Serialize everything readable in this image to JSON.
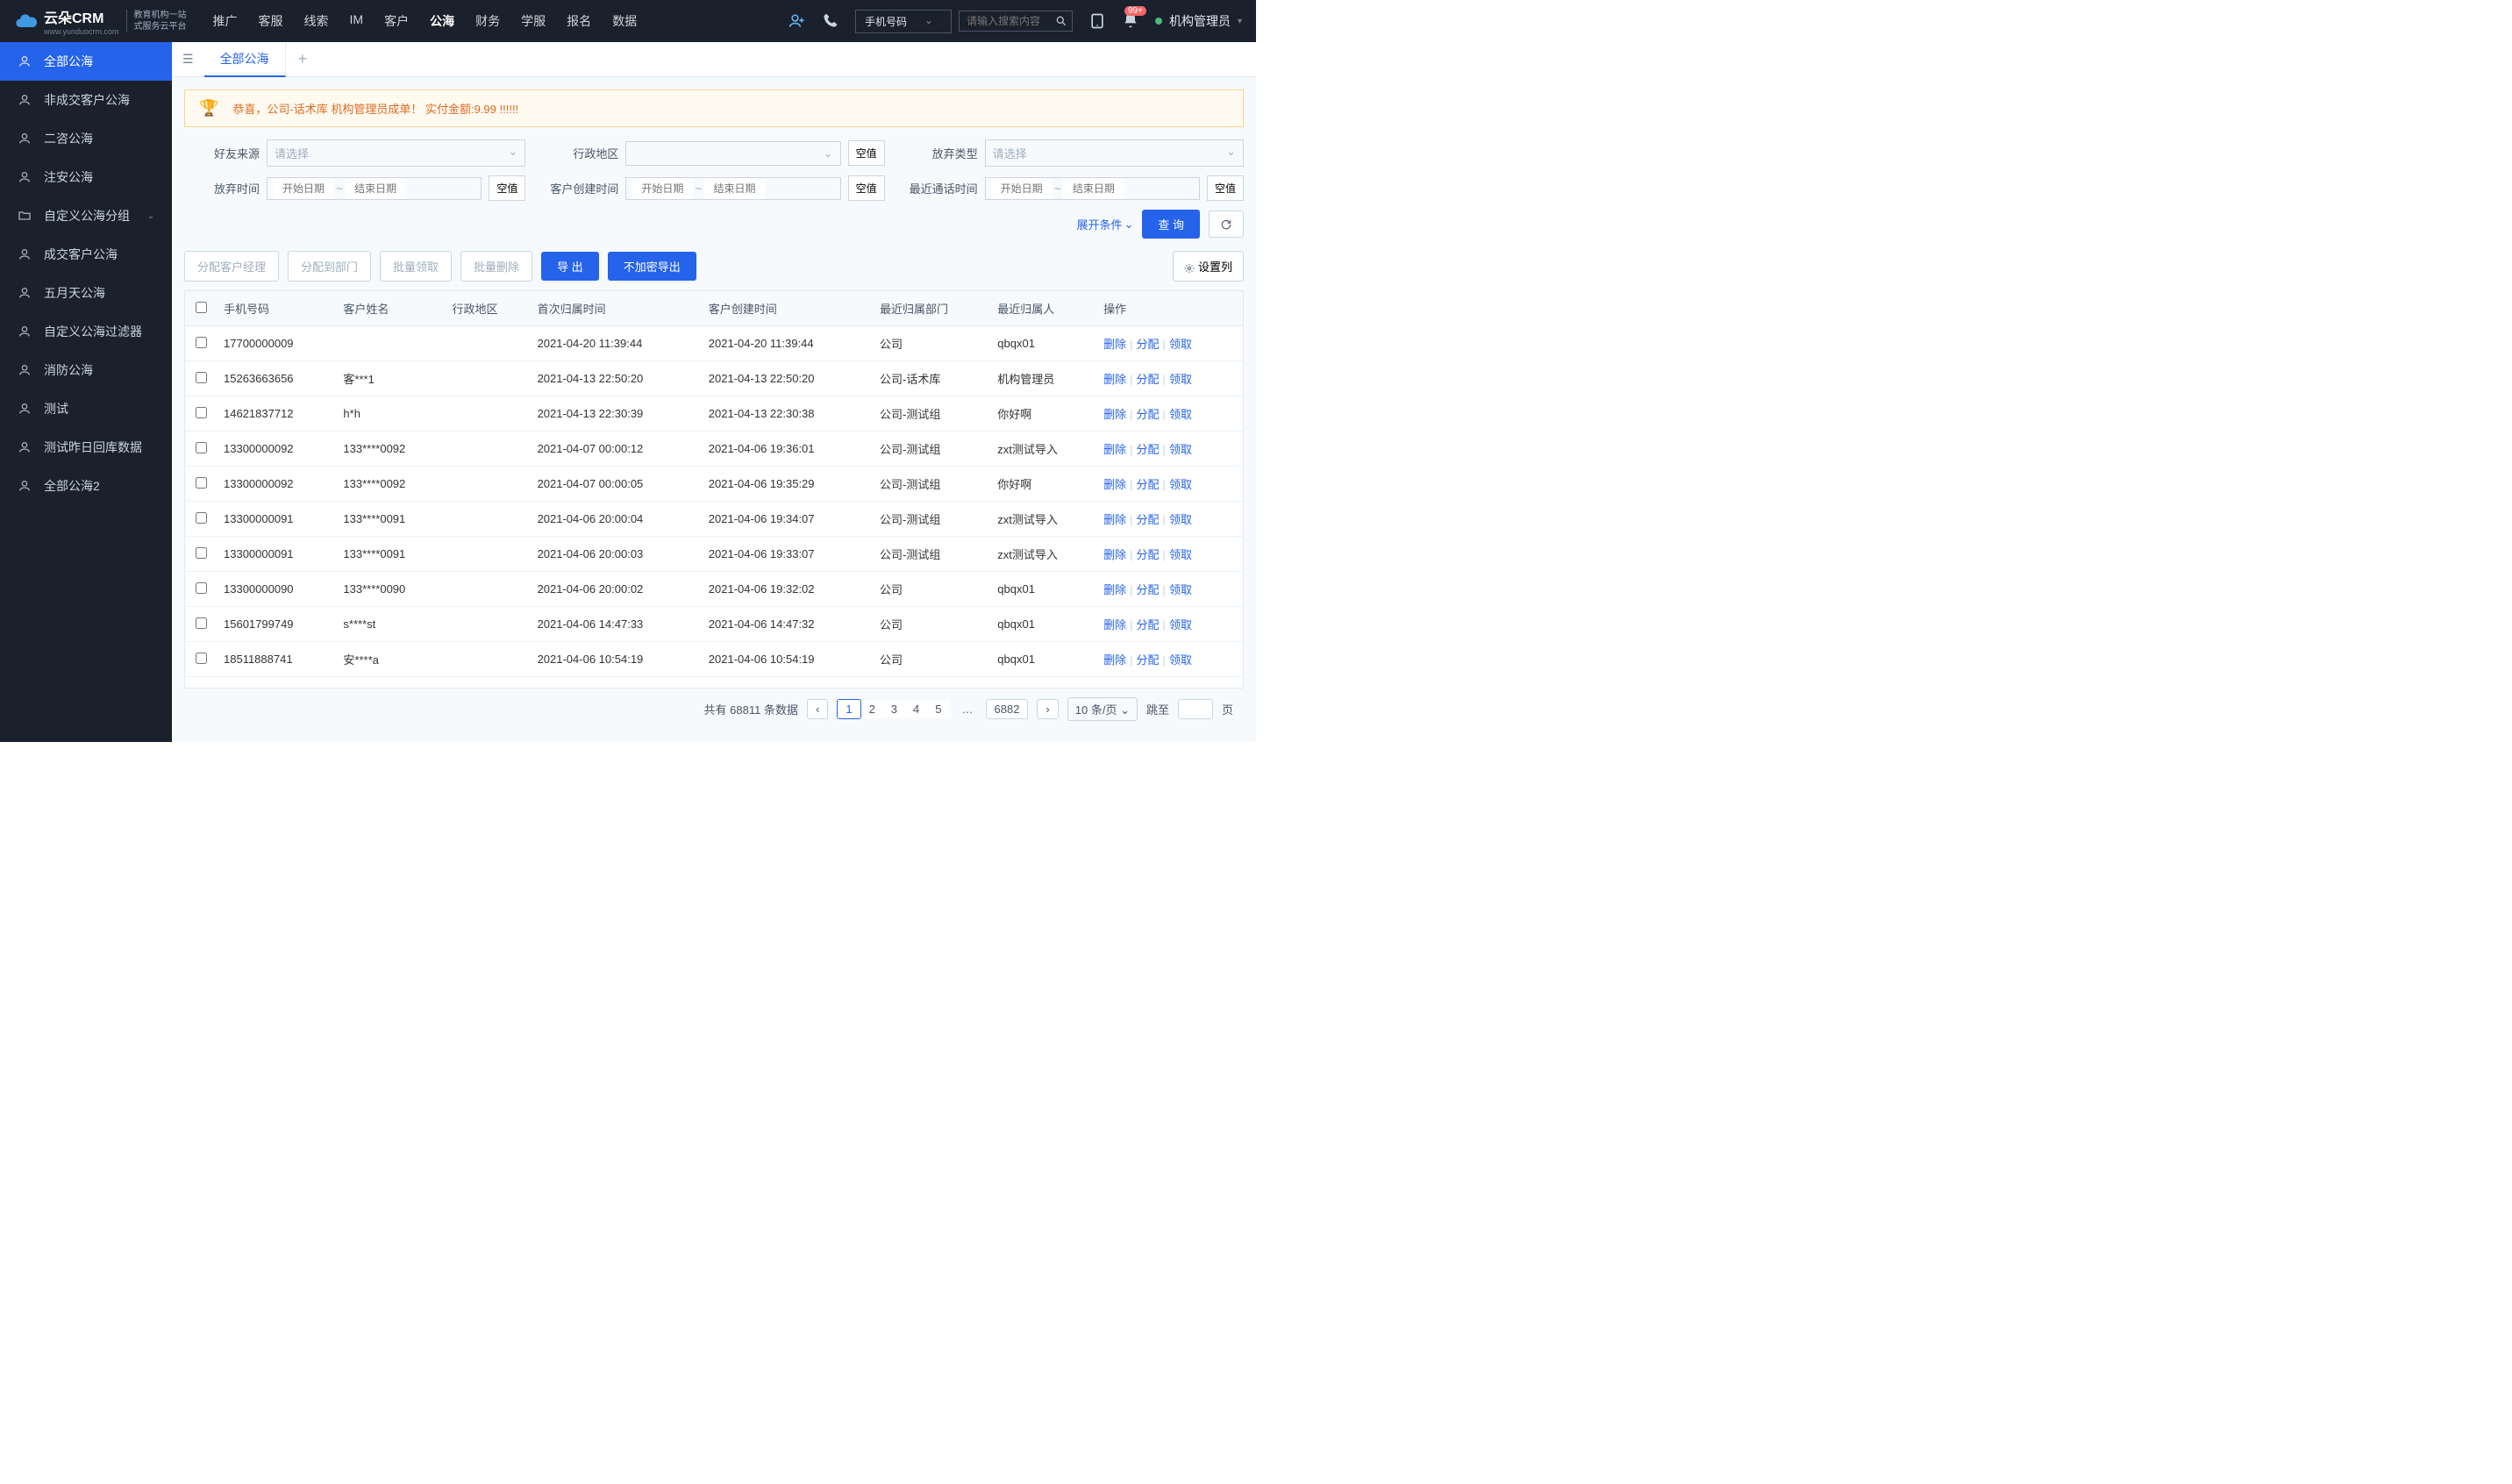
{
  "header": {
    "logo_text": "云朵CRM",
    "logo_url": "www.yunduocrm.com",
    "logo_sub1": "教育机构一站",
    "logo_sub2": "式服务云平台",
    "nav": [
      "推广",
      "客服",
      "线索",
      "IM",
      "客户",
      "公海",
      "财务",
      "学服",
      "报名",
      "数据"
    ],
    "nav_active_index": 5,
    "search_type": "手机号码",
    "search_placeholder": "请输入搜索内容",
    "badge_count": "99+",
    "user_label": "机构管理员"
  },
  "sidebar": {
    "items": [
      {
        "label": "全部公海",
        "icon": "users",
        "active": true
      },
      {
        "label": "非成交客户公海",
        "icon": "users"
      },
      {
        "label": "二咨公海",
        "icon": "users"
      },
      {
        "label": "注安公海",
        "icon": "users"
      },
      {
        "label": "自定义公海分组",
        "icon": "folder",
        "expandable": true
      },
      {
        "label": "成交客户公海",
        "icon": "users"
      },
      {
        "label": "五月天公海",
        "icon": "users"
      },
      {
        "label": "自定义公海过滤器",
        "icon": "users"
      },
      {
        "label": "消防公海",
        "icon": "users"
      },
      {
        "label": "测试",
        "icon": "users"
      },
      {
        "label": "测试昨日回库数据",
        "icon": "users"
      },
      {
        "label": "全部公海2",
        "icon": "users"
      }
    ]
  },
  "tabs": {
    "main_tab": "全部公海"
  },
  "banner": {
    "text": "恭喜，公司-话术库  机构管理员成单！  实付金额:9.99 !!!!!!"
  },
  "filters": {
    "friend_source": {
      "label": "好友来源",
      "placeholder": "请选择"
    },
    "admin_region": {
      "label": "行政地区",
      "empty_btn": "空值"
    },
    "abandon_type": {
      "label": "放弃类型",
      "placeholder": "请选择"
    },
    "abandon_time": {
      "label": "放弃时间",
      "start": "开始日期",
      "end": "结束日期",
      "empty_btn": "空值"
    },
    "create_time": {
      "label": "客户创建时间",
      "start": "开始日期",
      "end": "结束日期",
      "empty_btn": "空值"
    },
    "call_time": {
      "label": "最近通话时间",
      "start": "开始日期",
      "end": "结束日期",
      "empty_btn": "空值"
    },
    "expand_btn": "展开条件",
    "query_btn": "查 询"
  },
  "actions": {
    "assign_mgr": "分配客户经理",
    "assign_dept": "分配到部门",
    "batch_claim": "批量领取",
    "batch_delete": "批量删除",
    "export": "导 出",
    "export_plain": "不加密导出",
    "set_columns": "设置列"
  },
  "table": {
    "columns": [
      "手机号码",
      "客户姓名",
      "行政地区",
      "首次归属时间",
      "客户创建时间",
      "最近归属部门",
      "最近归属人",
      "操作"
    ],
    "ops": {
      "delete": "删除",
      "assign": "分配",
      "claim": "领取"
    },
    "rows": [
      {
        "phone": "17700000009",
        "name": "",
        "region": "",
        "first_time": "2021-04-20 11:39:44",
        "create_time": "2021-04-20 11:39:44",
        "dept": "公司",
        "owner": "qbqx01"
      },
      {
        "phone": "15263663656",
        "name": "客***1",
        "region": "",
        "first_time": "2021-04-13 22:50:20",
        "create_time": "2021-04-13 22:50:20",
        "dept": "公司-话术库",
        "owner": "机构管理员"
      },
      {
        "phone": "14621837712",
        "name": "h*h",
        "region": "",
        "first_time": "2021-04-13 22:30:39",
        "create_time": "2021-04-13 22:30:38",
        "dept": "公司-测试组",
        "owner": "你好啊"
      },
      {
        "phone": "13300000092",
        "name": "133****0092",
        "region": "",
        "first_time": "2021-04-07 00:00:12",
        "create_time": "2021-04-06 19:36:01",
        "dept": "公司-测试组",
        "owner": "zxt测试导入"
      },
      {
        "phone": "13300000092",
        "name": "133****0092",
        "region": "",
        "first_time": "2021-04-07 00:00:05",
        "create_time": "2021-04-06 19:35:29",
        "dept": "公司-测试组",
        "owner": "你好啊"
      },
      {
        "phone": "13300000091",
        "name": "133****0091",
        "region": "",
        "first_time": "2021-04-06 20:00:04",
        "create_time": "2021-04-06 19:34:07",
        "dept": "公司-测试组",
        "owner": "zxt测试导入"
      },
      {
        "phone": "13300000091",
        "name": "133****0091",
        "region": "",
        "first_time": "2021-04-06 20:00:03",
        "create_time": "2021-04-06 19:33:07",
        "dept": "公司-测试组",
        "owner": "zxt测试导入"
      },
      {
        "phone": "13300000090",
        "name": "133****0090",
        "region": "",
        "first_time": "2021-04-06 20:00:02",
        "create_time": "2021-04-06 19:32:02",
        "dept": "公司",
        "owner": "qbqx01"
      },
      {
        "phone": "15601799749",
        "name": "s****st",
        "region": "",
        "first_time": "2021-04-06 14:47:33",
        "create_time": "2021-04-06 14:47:32",
        "dept": "公司",
        "owner": "qbqx01"
      },
      {
        "phone": "18511888741",
        "name": "安****a",
        "region": "",
        "first_time": "2021-04-06 10:54:19",
        "create_time": "2021-04-06 10:54:19",
        "dept": "公司",
        "owner": "qbqx01"
      }
    ]
  },
  "pagination": {
    "total_prefix": "共有",
    "total": "68811",
    "total_suffix": "条数据",
    "pages": [
      "1",
      "2",
      "3",
      "4",
      "5"
    ],
    "last_page": "6882",
    "per_page": "10 条/页",
    "jump_prefix": "跳至",
    "jump_suffix": "页"
  }
}
